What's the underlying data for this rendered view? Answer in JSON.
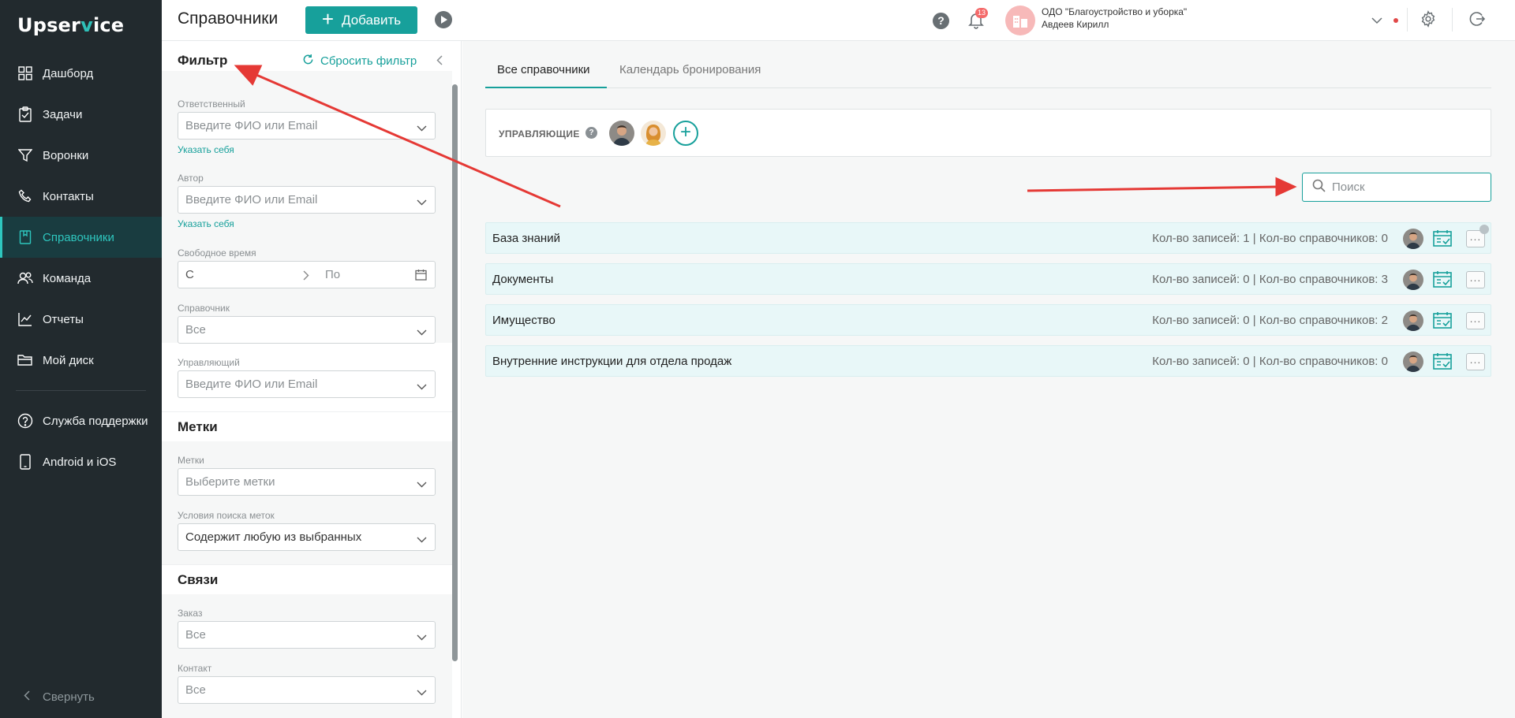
{
  "app": {
    "logo": "Upservice",
    "logo_part1": "Upser",
    "logo_v": "v",
    "logo_part2": "ice"
  },
  "sidebar": {
    "items": [
      {
        "label": "Дашборд",
        "icon": "dashboard-icon"
      },
      {
        "label": "Задачи",
        "icon": "tasks-icon"
      },
      {
        "label": "Воронки",
        "icon": "funnel-icon"
      },
      {
        "label": "Контакты",
        "icon": "contacts-icon"
      },
      {
        "label": "Справочники",
        "icon": "book-icon",
        "active": true
      },
      {
        "label": "Команда",
        "icon": "team-icon"
      },
      {
        "label": "Отчеты",
        "icon": "reports-icon"
      },
      {
        "label": "Мой диск",
        "icon": "folder-icon"
      }
    ],
    "bottom_items": [
      {
        "label": "Служба поддержки",
        "icon": "support-icon"
      },
      {
        "label": "Android и iOS",
        "icon": "mobile-icon"
      }
    ],
    "collapse_label": "Свернуть"
  },
  "header": {
    "title": "Справочники",
    "add_label": "Добавить",
    "notifications_count": "13",
    "org_name": "ОДО \"Благоустройство и уборка\"",
    "user_name": "Авдеев Кирилл"
  },
  "filter": {
    "title": "Фильтр",
    "reset_label": "Сбросить фильтр",
    "responsible": {
      "label": "Ответственный",
      "placeholder": "Введите ФИО или Email",
      "self_link": "Указать себя"
    },
    "author": {
      "label": "Автор",
      "placeholder": "Введите ФИО или Email",
      "self_link": "Указать себя"
    },
    "free_time": {
      "label": "Свободное время",
      "from": "С",
      "to": "По"
    },
    "directory": {
      "label": "Справочник",
      "value": "Все"
    },
    "manager": {
      "label": "Управляющий",
      "placeholder": "Введите ФИО или Email"
    },
    "tags_section": "Метки",
    "tags": {
      "label": "Метки",
      "placeholder": "Выберите метки"
    },
    "tag_condition": {
      "label": "Условия поиска меток",
      "value": "Содержит любую из выбранных"
    },
    "links_section": "Связи",
    "order": {
      "label": "Заказ",
      "value": "Все"
    },
    "contact": {
      "label": "Контакт",
      "value": "Все"
    }
  },
  "main": {
    "tabs": [
      {
        "label": "Все справочники",
        "active": true
      },
      {
        "label": "Календарь бронирования"
      }
    ],
    "managers_label": "УПРАВЛЯЮЩИЕ",
    "managers_help": "?",
    "search_placeholder": "Поиск",
    "rows": [
      {
        "name": "База знаний",
        "stats": "Кол-во записей: 1 | Кол-во справочников: 0"
      },
      {
        "name": "Документы",
        "stats": "Кол-во записей: 0 | Кол-во справочников: 3"
      },
      {
        "name": "Имущество",
        "stats": "Кол-во записей: 0 | Кол-во справочников: 2"
      },
      {
        "name": "Внутренние инструкции для отдела продаж",
        "stats": "Кол-во записей: 0 | Кол-во справочников: 0"
      }
    ]
  },
  "colors": {
    "accent": "#17a09b",
    "sidebar_bg": "#222a2e",
    "annotation_arrow": "#e53935"
  }
}
